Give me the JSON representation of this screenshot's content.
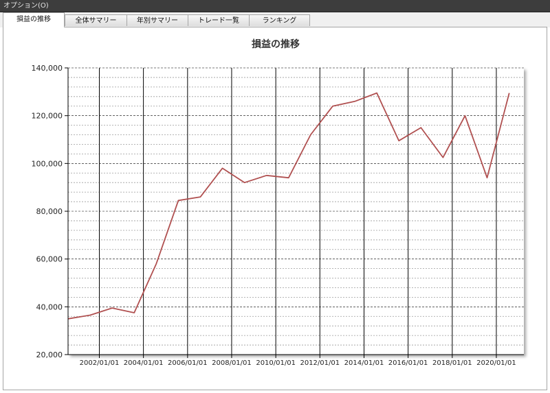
{
  "window": {
    "title": "オプション(O)"
  },
  "tabs": [
    {
      "label": "損益の推移",
      "active": true
    },
    {
      "label": "全体サマリー",
      "active": false
    },
    {
      "label": "年別サマリー",
      "active": false
    },
    {
      "label": "トレード一覧",
      "active": false
    },
    {
      "label": "ランキング",
      "active": false
    }
  ],
  "colors": {
    "line": "#b05050",
    "grid_major": "#000000",
    "grid_minor": "#9a9a9a"
  },
  "chart_data": {
    "type": "line",
    "title": "損益の推移",
    "ylim": [
      20000,
      140000
    ],
    "y_ticks": [
      "20,000",
      "40,000",
      "60,000",
      "80,000",
      "100,000",
      "120,000",
      "140,000"
    ],
    "y_tick_values": [
      20000,
      40000,
      60000,
      80000,
      100000,
      120000,
      140000
    ],
    "xlim": [
      "2000-08-01",
      "2021-04-01"
    ],
    "x_ticks": [
      "2002/01/01",
      "2004/01/01",
      "2006/01/01",
      "2008/01/01",
      "2010/01/01",
      "2012/01/01",
      "2014/01/01",
      "2016/01/01",
      "2018/01/01",
      "2020/01/01"
    ],
    "x_tick_dates": [
      "2002-01-01",
      "2004-01-01",
      "2006-01-01",
      "2008-01-01",
      "2010-01-01",
      "2012-01-01",
      "2014-01-01",
      "2016-01-01",
      "2018-01-01",
      "2020-01-01"
    ],
    "grid": true,
    "series": [
      {
        "points": [
          {
            "x": "2000-08-01",
            "y": 35000
          },
          {
            "x": "2001-08-01",
            "y": 36500
          },
          {
            "x": "2002-08-01",
            "y": 39500
          },
          {
            "x": "2003-08-01",
            "y": 37500
          },
          {
            "x": "2004-08-01",
            "y": 58000
          },
          {
            "x": "2005-08-01",
            "y": 84500
          },
          {
            "x": "2006-08-01",
            "y": 86000
          },
          {
            "x": "2007-08-01",
            "y": 98000
          },
          {
            "x": "2008-08-01",
            "y": 92000
          },
          {
            "x": "2009-08-01",
            "y": 95000
          },
          {
            "x": "2010-08-01",
            "y": 94000
          },
          {
            "x": "2011-08-01",
            "y": 112000
          },
          {
            "x": "2012-08-01",
            "y": 124000
          },
          {
            "x": "2013-08-01",
            "y": 126000
          },
          {
            "x": "2014-08-01",
            "y": 129500
          },
          {
            "x": "2015-08-01",
            "y": 109500
          },
          {
            "x": "2016-08-01",
            "y": 115000
          },
          {
            "x": "2017-08-01",
            "y": 102500
          },
          {
            "x": "2018-08-01",
            "y": 120000
          },
          {
            "x": "2019-08-01",
            "y": 94000
          },
          {
            "x": "2020-08-01",
            "y": 129500
          }
        ]
      }
    ]
  }
}
